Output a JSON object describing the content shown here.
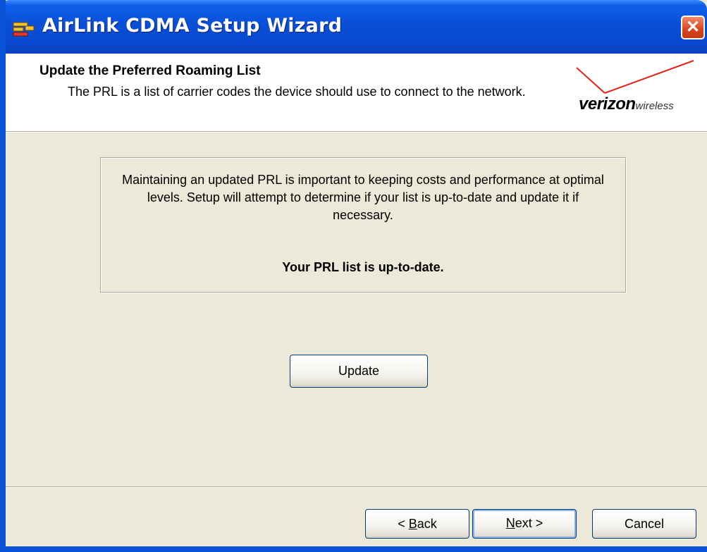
{
  "window": {
    "title": "AirLink CDMA Setup Wizard",
    "close_glyph": "✕",
    "accent_color": "#0A4FD8"
  },
  "header": {
    "title": "Update the Preferred Roaming List",
    "description": "The PRL is a list of carrier codes the device should use to connect to the network.",
    "logo": {
      "brand": "verizon",
      "sub": "wireless"
    }
  },
  "main": {
    "info_text": "Maintaining an updated PRL is important to keeping costs and performance at optimal levels. Setup will attempt to determine if your list is up-to-date and update it if necessary.",
    "status_text": "Your PRL list is up-to-date.",
    "update_button": "Update"
  },
  "footer": {
    "back_prefix": "< ",
    "back_mnemonic": "B",
    "back_rest": "ack",
    "next_mnemonic": "N",
    "next_rest": "ext >",
    "cancel_label": "Cancel"
  }
}
